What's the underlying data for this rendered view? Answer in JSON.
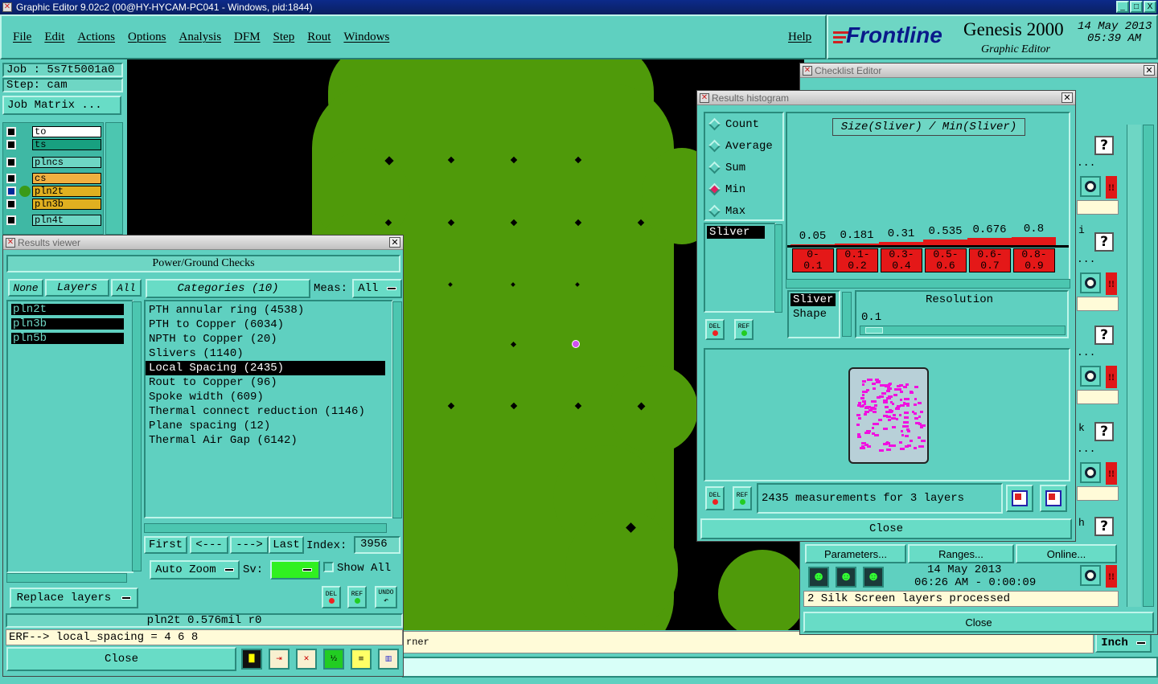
{
  "app": {
    "title": "Graphic Editor 9.02c2 (00@HY-HYCAM-PC041 - Windows, pid:1844)",
    "title_min": "_",
    "title_max": "□",
    "title_close": "X"
  },
  "menu": [
    "File",
    "Edit",
    "Actions",
    "Options",
    "Analysis",
    "DFM",
    "Step",
    "Rout",
    "Windows"
  ],
  "help": "Help",
  "brand": {
    "logo": "Frontline",
    "product": "Genesis 2000",
    "subtitle": "Graphic Editor",
    "date": "14 May 2013",
    "time": "05:39 AM"
  },
  "job": {
    "job": "Job : 5s7t5001a0",
    "step": "Step: cam",
    "matrix": "Job Matrix ..."
  },
  "layers": [
    {
      "name": "to",
      "color": "#ffffff"
    },
    {
      "name": "ts",
      "color": "#18a080"
    },
    {
      "name": "plncs",
      "color": "#6ed6c4"
    },
    {
      "name": "cs",
      "color": "#f0b040"
    },
    {
      "name": "pln2t",
      "color": "#e0b020"
    },
    {
      "name": "pln3b",
      "color": "#e0b020"
    },
    {
      "name": "pln4t",
      "color": "#6ed6c4"
    }
  ],
  "results_viewer": {
    "title": "Results viewer",
    "header": "Power/Ground Checks",
    "none": "None",
    "layers_btn": "Layers",
    "all": "All",
    "categories_btn": "Categories (10)",
    "meas_label": "Meas:",
    "meas_value": "All",
    "layer_items": [
      "pln2t",
      "pln3b",
      "pln5b"
    ],
    "categories": [
      "PTH annular ring (4538)",
      "PTH to Copper (6034)",
      "NPTH to Copper (20)",
      "Slivers (1140)",
      "Local Spacing (2435)",
      "Rout to Copper (96)",
      "Spoke width (609)",
      "Thermal connect reduction (1146)",
      "Plane spacing (12)",
      "Thermal Air Gap (6142)"
    ],
    "selected": "Local Spacing (2435)",
    "first": "First",
    "prev": "<---",
    "next": "--->",
    "last": "Last",
    "index_label": "Index:",
    "index_value": "3956",
    "auto_zoom": "Auto Zoom",
    "sv": "Sv:",
    "show_all": "Show All",
    "replace": "Replace layers",
    "status": "pln2t 0.576mil  r0",
    "erf": "ERF--> local_spacing = 4 6 8",
    "close": "Close",
    "del": "DEL",
    "ref": "REF",
    "undo": "UNDO"
  },
  "histogram": {
    "title": "Results histogram",
    "modes": [
      "Count",
      "Average",
      "Sum",
      "Min",
      "Max"
    ],
    "selected_mode": "Min",
    "label": "Size(Sliver) / Min(Sliver)",
    "list": [
      "Sliver"
    ],
    "list2": [
      "Sliver",
      "Shape"
    ],
    "resolution_label": "Resolution",
    "resolution_value": "0.1",
    "summary": "2435 measurements for 3 layers",
    "close": "Close",
    "del": "DEL",
    "ref": "REF"
  },
  "chart_data": {
    "type": "bar",
    "categories": [
      "0-0.1",
      "0.1-0.2",
      "0.3-0.4",
      "0.5-0.6",
      "0.6-0.7",
      "0.8-0.9"
    ],
    "labels": [
      "0-\n0.1",
      "0.1-\n0.2",
      "0.3-\n0.4",
      "0.5-\n0.6",
      "0.6-\n0.7",
      "0.8-\n0.9"
    ],
    "values": [
      0.05,
      0.181,
      0.31,
      0.535,
      0.676,
      0.8
    ],
    "ylim": [
      0,
      1
    ],
    "title": "Size(Sliver) / Min(Sliver)"
  },
  "checklist": {
    "title": "Checklist Editor",
    "parameters": "Parameters...",
    "ranges": "Ranges...",
    "online": "Online...",
    "date": "14 May 2013",
    "time": "06:26 AM - 0:00:09",
    "status": "2 Silk Screen layers processed",
    "close": "Close",
    "dots": "...",
    "q": "?",
    "bang": "!!",
    "side_letters": [
      "i",
      "k",
      "h"
    ]
  },
  "bottom": {
    "corner": "rner",
    "units": "Inch"
  }
}
